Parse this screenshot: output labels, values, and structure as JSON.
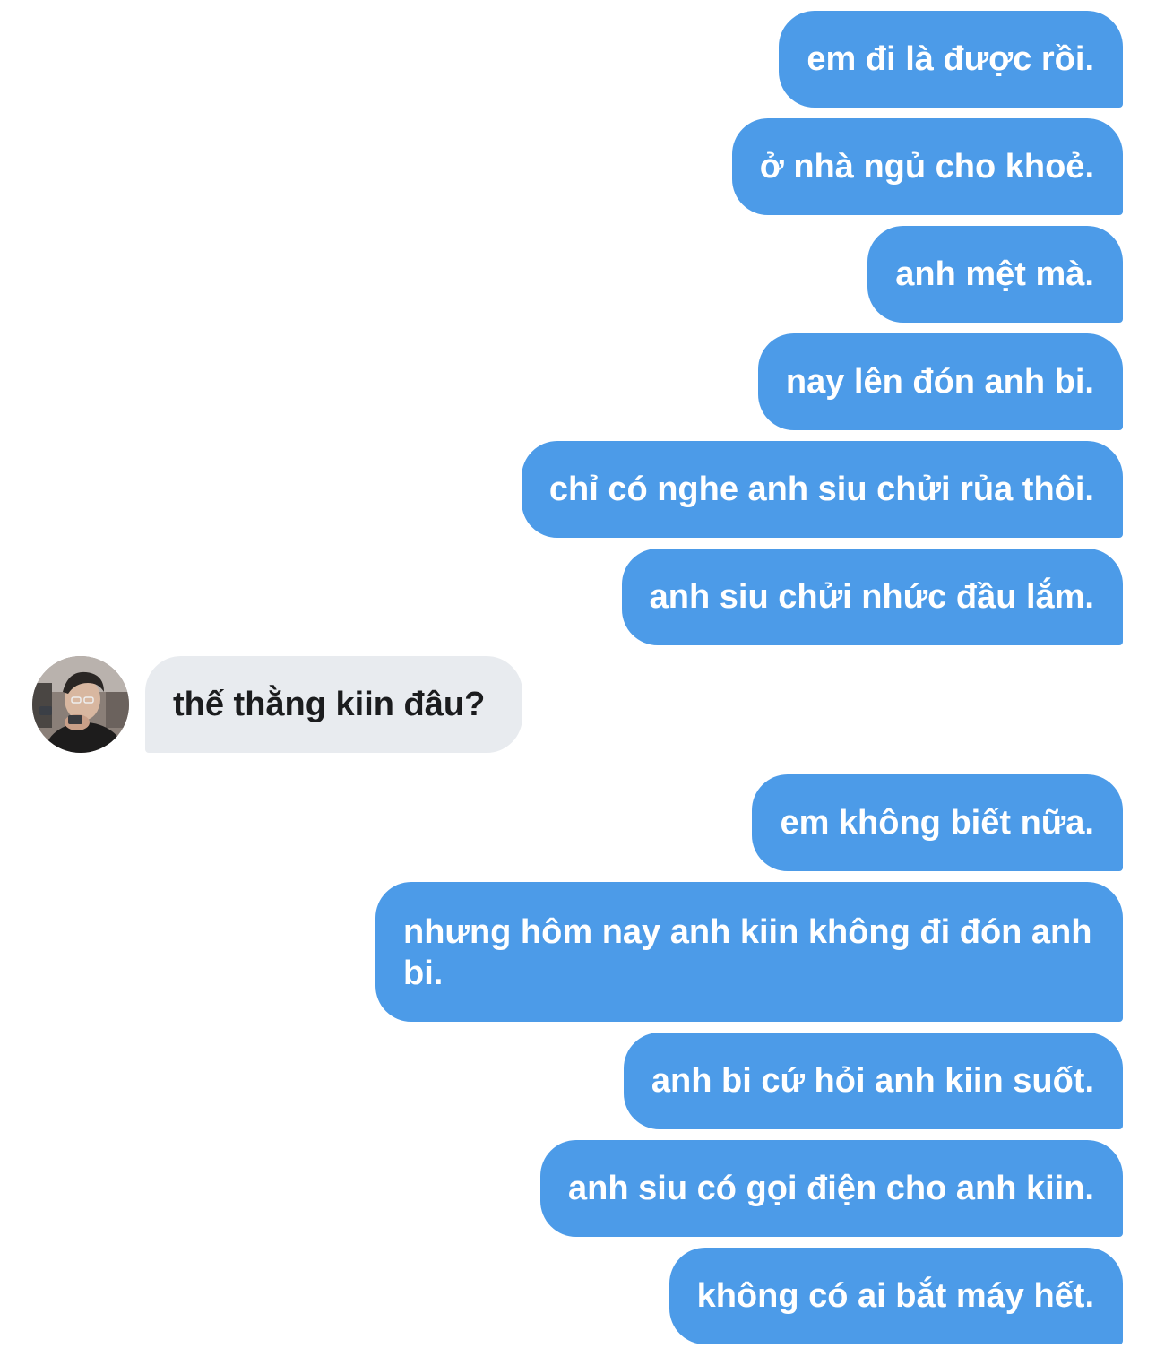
{
  "conversation": {
    "messages": [
      {
        "sender": "me",
        "text": "em đi là được rồi."
      },
      {
        "sender": "me",
        "text": "ở nhà ngủ cho khoẻ."
      },
      {
        "sender": "me",
        "text": "anh mệt mà."
      },
      {
        "sender": "me",
        "text": "nay lên đón anh bi."
      },
      {
        "sender": "me",
        "text": "chỉ có nghe anh siu chửi rủa thôi."
      },
      {
        "sender": "me",
        "text": "anh siu chửi nhức đầu lắm."
      },
      {
        "sender": "other",
        "text": "thế thằng kiin đâu?"
      },
      {
        "sender": "me",
        "text": "em không biết nữa."
      },
      {
        "sender": "me",
        "text": "nhưng hôm nay anh kiin không đi đón anh bi."
      },
      {
        "sender": "me",
        "text": "anh bi cứ hỏi anh kiin suốt."
      },
      {
        "sender": "me",
        "text": "anh siu có gọi điện cho anh kiin."
      },
      {
        "sender": "me",
        "text": "không có ai bắt máy hết."
      }
    ]
  },
  "colors": {
    "sent_bubble": "#4c9be8",
    "received_bubble": "#e8ebef",
    "sent_text": "#ffffff",
    "received_text": "#1b1c1e"
  },
  "icons": {
    "avatar": "contact-avatar-photo"
  }
}
